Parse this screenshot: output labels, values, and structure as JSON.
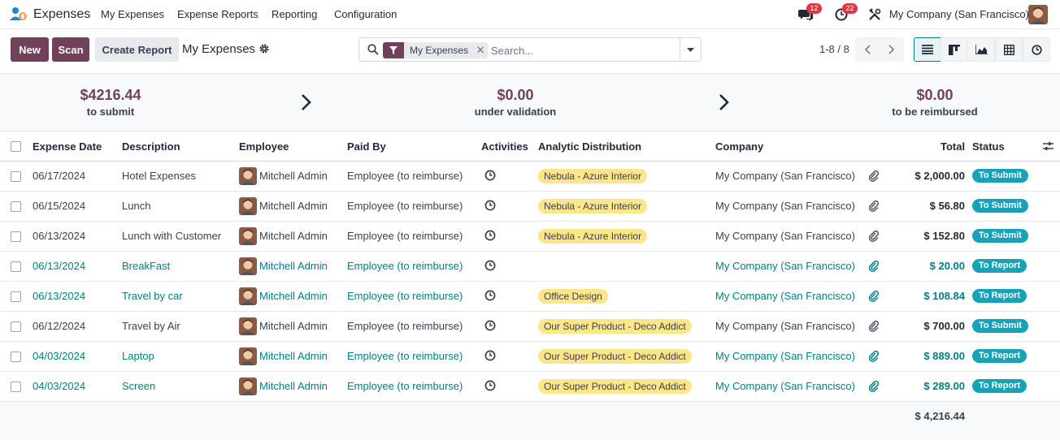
{
  "app": {
    "name": "Expenses",
    "menu": [
      "My Expenses",
      "Expense Reports",
      "Reporting",
      "Configuration"
    ],
    "messages_count": "12",
    "activities_count": "22",
    "company": "My Company (San Francisco)"
  },
  "control": {
    "new_label": "New",
    "scan_label": "Scan",
    "create_report_label": "Create Report",
    "breadcrumb": "My Expenses",
    "facet_label": "My Expenses",
    "search_placeholder": "Search...",
    "pager": "1-8 / 8"
  },
  "summary": [
    {
      "amount": "$4216.44",
      "label": "to submit"
    },
    {
      "amount": "$0.00",
      "label": "under validation"
    },
    {
      "amount": "$0.00",
      "label": "to be reimbursed"
    }
  ],
  "columns": {
    "date": "Expense Date",
    "description": "Description",
    "employee": "Employee",
    "paid_by": "Paid By",
    "activities": "Activities",
    "analytic": "Analytic Distribution",
    "company": "Company",
    "total": "Total",
    "status": "Status"
  },
  "rows": [
    {
      "date": "06/17/2024",
      "description": "Hotel Expenses",
      "employee": "Mitchell Admin",
      "paid_by": "Employee (to reimburse)",
      "analytic": "Nebula - Azure Interior",
      "company": "My Company (San Francisco)",
      "total": "$ 2,000.00",
      "status": "To Submit"
    },
    {
      "date": "06/15/2024",
      "description": "Lunch",
      "employee": "Mitchell Admin",
      "paid_by": "Employee (to reimburse)",
      "analytic": "Nebula - Azure Interior",
      "company": "My Company (San Francisco)",
      "total": "$ 56.80",
      "status": "To Submit"
    },
    {
      "date": "06/13/2024",
      "description": "Lunch with Customer",
      "employee": "Mitchell Admin",
      "paid_by": "Employee (to reimburse)",
      "analytic": "Nebula - Azure Interior",
      "company": "My Company (San Francisco)",
      "total": "$ 152.80",
      "status": "To Submit"
    },
    {
      "date": "06/13/2024",
      "description": "BreakFast",
      "employee": "Mitchell Admin",
      "paid_by": "Employee (to reimburse)",
      "analytic": "",
      "company": "My Company (San Francisco)",
      "total": "$ 20.00",
      "status": "To Report"
    },
    {
      "date": "06/13/2024",
      "description": "Travel by car",
      "employee": "Mitchell Admin",
      "paid_by": "Employee (to reimburse)",
      "analytic": "Office Design",
      "company": "My Company (San Francisco)",
      "total": "$ 108.84",
      "status": "To Report"
    },
    {
      "date": "06/12/2024",
      "description": "Travel by Air",
      "employee": "Mitchell Admin",
      "paid_by": "Employee (to reimburse)",
      "analytic": "Our Super Product - Deco Addict",
      "company": "My Company (San Francisco)",
      "total": "$ 700.00",
      "status": "To Submit"
    },
    {
      "date": "04/03/2024",
      "description": "Laptop",
      "employee": "Mitchell Admin",
      "paid_by": "Employee (to reimburse)",
      "analytic": "Our Super Product - Deco Addict",
      "company": "My Company (San Francisco)",
      "total": "$ 889.00",
      "status": "To Report"
    },
    {
      "date": "04/03/2024",
      "description": "Screen",
      "employee": "Mitchell Admin",
      "paid_by": "Employee (to reimburse)",
      "analytic": "Our Super Product - Deco Addict",
      "company": "My Company (San Francisco)",
      "total": "$ 289.00",
      "status": "To Report"
    }
  ],
  "grand_total": "$ 4,216.44"
}
